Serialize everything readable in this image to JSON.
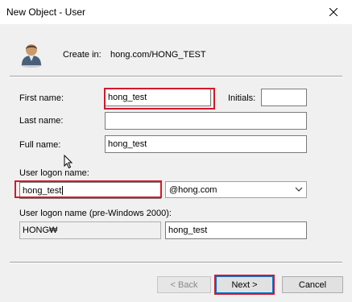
{
  "window": {
    "title": "New Object - User"
  },
  "header": {
    "create_in_label": "Create in:",
    "create_in_value": "hong.com/HONG_TEST",
    "icon": "user-icon"
  },
  "form": {
    "first_name_label": "First name:",
    "first_name_value": "hong_test",
    "initials_label": "Initials:",
    "initials_value": "",
    "last_name_label": "Last name:",
    "last_name_value": "",
    "full_name_label": "Full name:",
    "full_name_value": "hong_test",
    "logon_name_label": "User logon name:",
    "logon_name_value": "hong_test",
    "domain_selected": "@hong.com",
    "pre2000_label": "User logon name (pre-Windows 2000):",
    "pre2000_domain_value": "HONG₩",
    "pre2000_name_value": "hong_test"
  },
  "buttons": {
    "back_label": "< Back",
    "next_label": "Next >",
    "cancel_label": "Cancel"
  },
  "colors": {
    "highlight": "#d11a2a",
    "default_button_border": "#0078d7"
  }
}
